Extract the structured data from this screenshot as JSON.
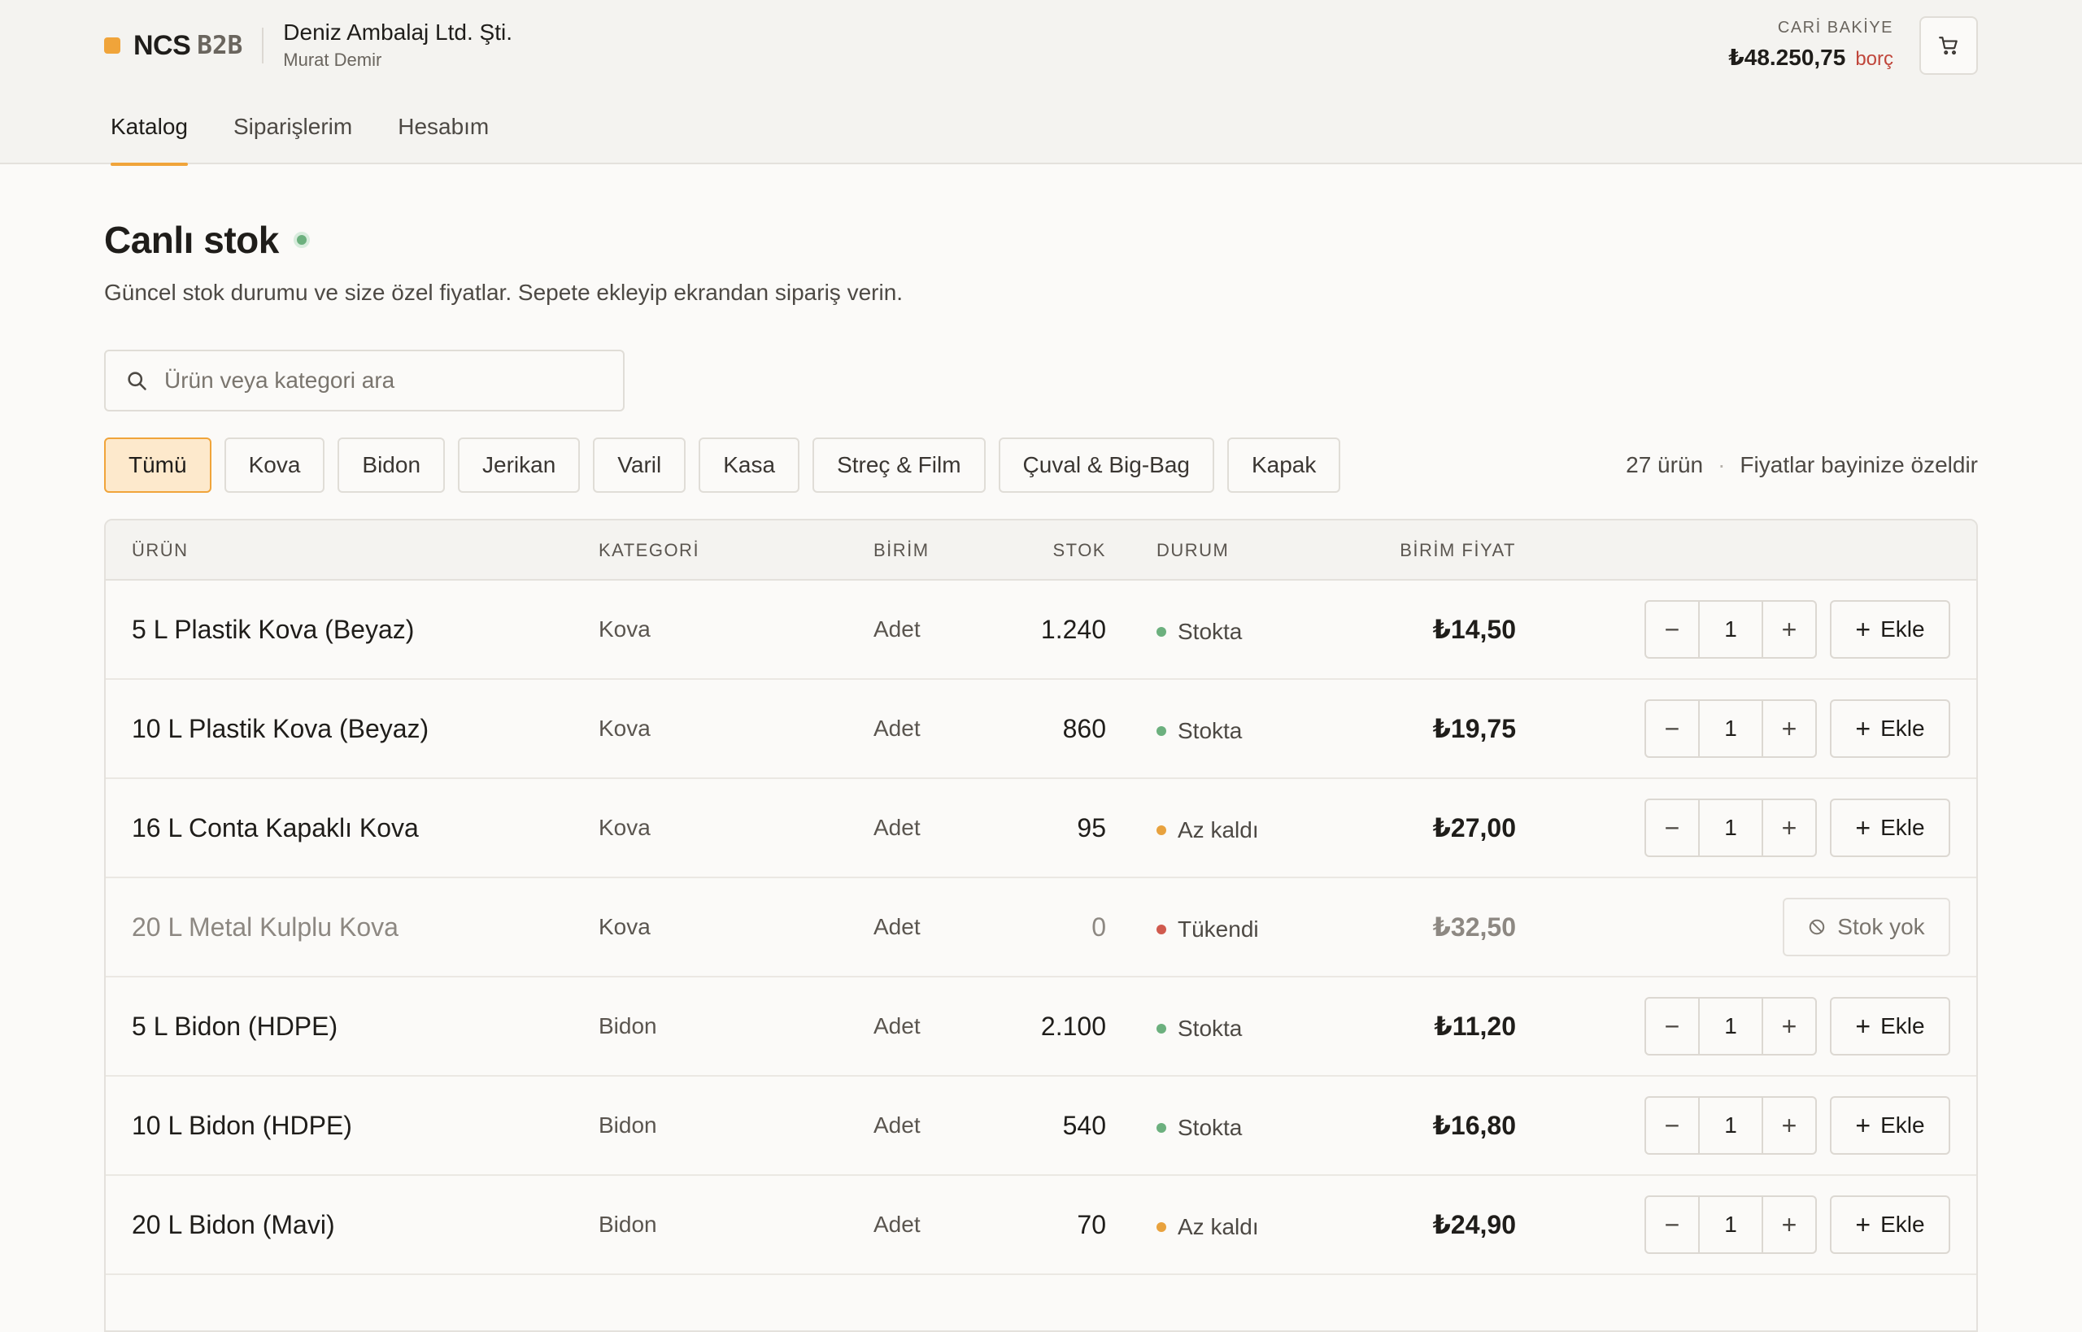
{
  "brand": {
    "name": "NCS",
    "suffix": "B2B",
    "color": "#f0a43a"
  },
  "company": {
    "name": "Deniz Ambalaj Ltd. Şti.",
    "user": "Murat Demir"
  },
  "balance": {
    "label": "CARİ BAKİYE",
    "amount": "₺48.250,75",
    "tag": "borç"
  },
  "nav": {
    "tabs": [
      {
        "label": "Katalog",
        "active": true
      },
      {
        "label": "Siparişlerim",
        "active": false
      },
      {
        "label": "Hesabım",
        "active": false
      }
    ]
  },
  "page": {
    "title": "Canlı stok",
    "subtitle": "Güncel stok durumu ve size özel fiyatlar. Sepete ekleyip ekrandan sipariş verin."
  },
  "search": {
    "placeholder": "Ürün veya kategori ara",
    "value": ""
  },
  "filters": {
    "chips": [
      "Tümü",
      "Kova",
      "Bidon",
      "Jerikan",
      "Varil",
      "Kasa",
      "Streç & Film",
      "Çuval & Big-Bag",
      "Kapak"
    ],
    "active": "Tümü"
  },
  "summary": {
    "count": "27 ürün",
    "sep": "·",
    "note": "Fiyatlar bayinize özeldir"
  },
  "table": {
    "headers": {
      "product": "ÜRÜN",
      "category": "KATEGORİ",
      "unit": "BİRİM",
      "stock": "STOK",
      "status": "DURUM",
      "price": "BİRİM FİYAT"
    },
    "status_colors": {
      "Stokta": "#6cb07e",
      "Az kaldı": "#e8a23e",
      "Tükendi": "#d05a4e"
    },
    "add_label": "Ekle",
    "nostock_label": "Stok yok",
    "rows": [
      {
        "name": "5 L Plastik Kova (Beyaz)",
        "category": "Kova",
        "unit": "Adet",
        "stock": "1.240",
        "status": "Stokta",
        "price": "₺14,50",
        "qty": "1",
        "available": true
      },
      {
        "name": "10 L Plastik Kova (Beyaz)",
        "category": "Kova",
        "unit": "Adet",
        "stock": "860",
        "status": "Stokta",
        "price": "₺19,75",
        "qty": "1",
        "available": true
      },
      {
        "name": "16 L Conta Kapaklı Kova",
        "category": "Kova",
        "unit": "Adet",
        "stock": "95",
        "status": "Az kaldı",
        "price": "₺27,00",
        "qty": "1",
        "available": true
      },
      {
        "name": "20 L Metal Kulplu Kova",
        "category": "Kova",
        "unit": "Adet",
        "stock": "0",
        "status": "Tükendi",
        "price": "₺32,50",
        "qty": "",
        "available": false
      },
      {
        "name": "5 L Bidon (HDPE)",
        "category": "Bidon",
        "unit": "Adet",
        "stock": "2.100",
        "status": "Stokta",
        "price": "₺11,20",
        "qty": "1",
        "available": true
      },
      {
        "name": "10 L Bidon (HDPE)",
        "category": "Bidon",
        "unit": "Adet",
        "stock": "540",
        "status": "Stokta",
        "price": "₺16,80",
        "qty": "1",
        "available": true
      },
      {
        "name": "20 L Bidon (Mavi)",
        "category": "Bidon",
        "unit": "Adet",
        "stock": "70",
        "status": "Az kaldı",
        "price": "₺24,90",
        "qty": "1",
        "available": true
      }
    ]
  }
}
